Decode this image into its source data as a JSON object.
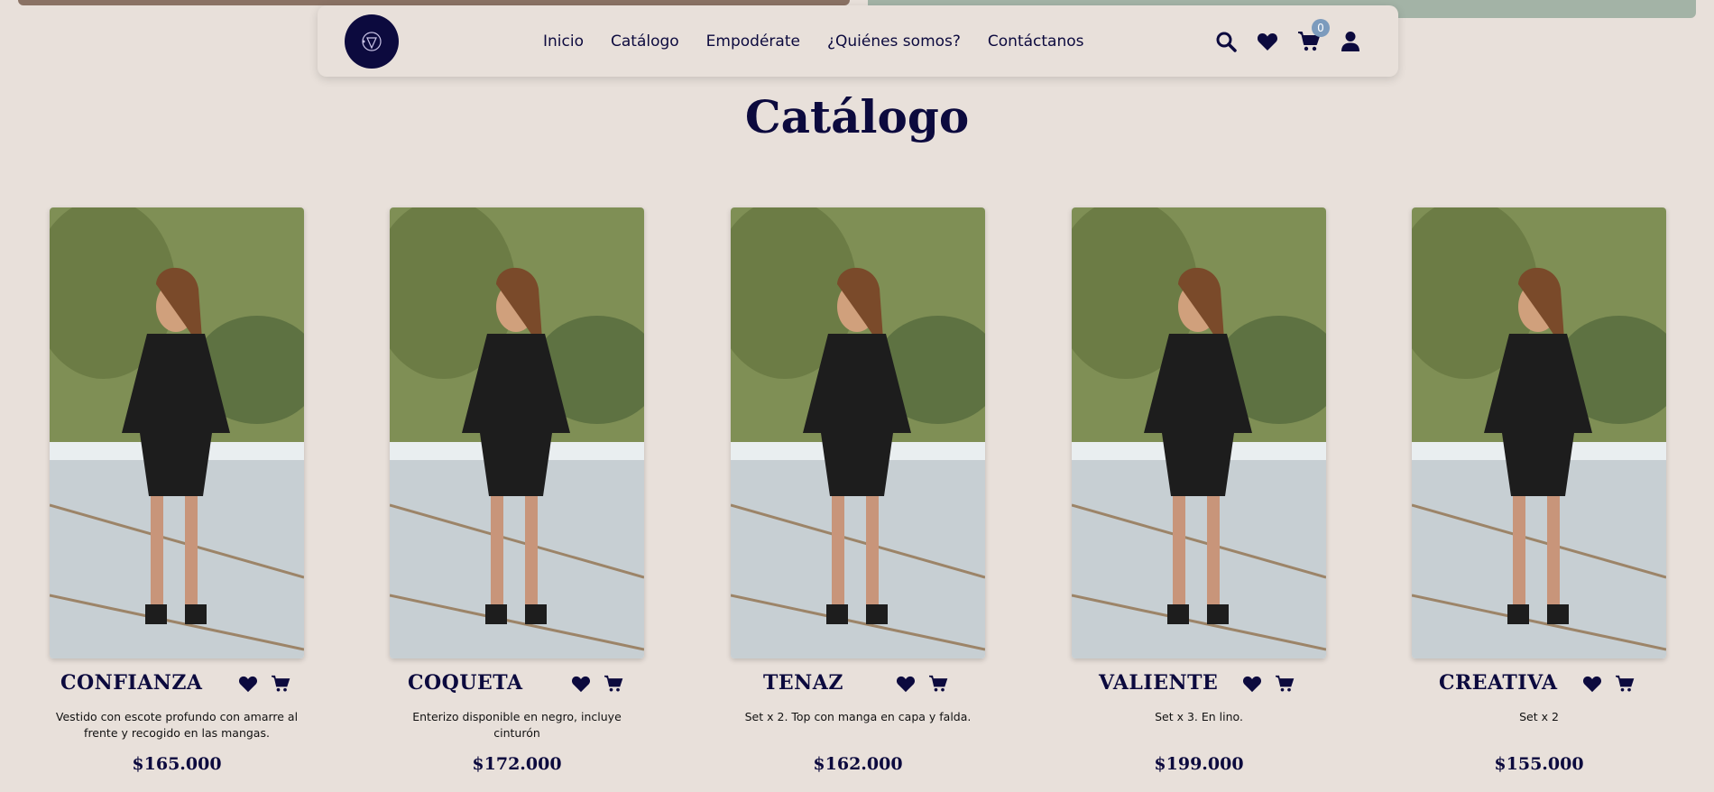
{
  "nav": {
    "logo_alt": "logo",
    "links": [
      "Inicio",
      "Catálogo",
      "Empodérate",
      "¿Quiénes somos?",
      "Contáctanos"
    ],
    "cart_count": "0",
    "icons": [
      "search-icon",
      "heart-icon",
      "cart-icon",
      "user-icon"
    ]
  },
  "page": {
    "title": "Catálogo"
  },
  "products": [
    {
      "name": "CONFIANZA",
      "desc": "Vestido con escote profundo con amarre al frente y recogido en las mangas.",
      "price": "$165.000"
    },
    {
      "name": "COQUETA",
      "desc": "Enterizo disponible en negro, incluye cinturón",
      "price": "$172.000"
    },
    {
      "name": "TENAZ",
      "desc": "Set x 2. Top con manga en capa y falda.",
      "price": "$162.000"
    },
    {
      "name": "VALIENTE",
      "desc": "Set x 3. En lino.",
      "price": "$199.000"
    },
    {
      "name": "CREATIVA",
      "desc": "Set x 2",
      "price": "$155.000"
    }
  ],
  "colors": {
    "primary": "#0c0a3e",
    "background": "#e8e0da",
    "badge": "#7c9bbd"
  }
}
